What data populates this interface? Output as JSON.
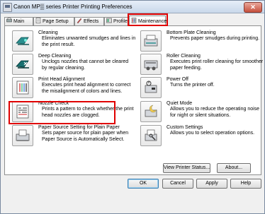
{
  "window": {
    "title": "Canon MP▒ series Printer Printing Preferences",
    "close_label": "✕"
  },
  "tabs": [
    {
      "label": "Main"
    },
    {
      "label": "Page Setup"
    },
    {
      "label": "Effects"
    },
    {
      "label": "Profiles"
    },
    {
      "label": "Maintenance"
    }
  ],
  "left_items": [
    {
      "title": "Cleaning",
      "desc": "Eliminates unwanted smudges and lines in\nthe print result.",
      "icon": "cleaning-icon"
    },
    {
      "title": "Deep Cleaning",
      "desc": "Unclogs nozzles that cannot be cleared\nby regular cleaning.",
      "icon": "deep-cleaning-icon"
    },
    {
      "title": "Print Head Alignment",
      "desc": "Executes print head alignment to correct\nthe misalignment of colors and lines.",
      "icon": "print-head-alignment-icon"
    },
    {
      "title": "Nozzle Check",
      "desc": "Prints a pattern to check whether the print\nhead nozzles are clogged.",
      "icon": "nozzle-check-icon"
    },
    {
      "title": "Paper Source Setting for Plain Paper",
      "desc": "Sets paper source for plain paper when\nPaper Source is Automatically Select.",
      "icon": "paper-source-icon"
    }
  ],
  "right_items": [
    {
      "title": "Bottom Plate Cleaning",
      "desc": "Prevents paper smudges during printing.",
      "icon": "bottom-plate-cleaning-icon"
    },
    {
      "title": "Roller Cleaning",
      "desc": "Executes print roller cleaning for smoother\npaper feeding.",
      "icon": "roller-cleaning-icon"
    },
    {
      "title": "Power Off",
      "desc": "Turns the printer off.",
      "icon": "power-off-icon"
    },
    {
      "title": "Quiet Mode",
      "desc": "Allows you to reduce the operating noise\nfor night or silent situations.",
      "icon": "quiet-mode-icon"
    },
    {
      "title": "Custom Settings",
      "desc": "Allows you to select operation options.",
      "icon": "custom-settings-icon"
    }
  ],
  "panel_buttons": {
    "view_status": "View Printer Status...",
    "about": "About..."
  },
  "dialog_buttons": {
    "ok": "OK",
    "cancel": "Cancel",
    "apply": "Apply",
    "help": "Help"
  },
  "colors": {
    "highlight": "#e00000",
    "icon_teal": "#1f8a8a"
  }
}
